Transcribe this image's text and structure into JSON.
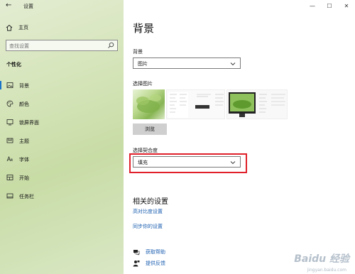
{
  "window": {
    "app_title": "设置",
    "controls": {
      "minimize": "—",
      "maximize": "☐",
      "close": "✕"
    }
  },
  "sidebar": {
    "home_label": "主页",
    "search": {
      "placeholder": "查找设置"
    },
    "section_title": "个性化",
    "items": [
      {
        "label": "背景",
        "icon": "image-icon",
        "selected": true
      },
      {
        "label": "颜色",
        "icon": "palette-icon",
        "selected": false
      },
      {
        "label": "锁屏界面",
        "icon": "lock-screen-icon",
        "selected": false
      },
      {
        "label": "主题",
        "icon": "theme-icon",
        "selected": false
      },
      {
        "label": "字体",
        "icon": "font-icon",
        "selected": false
      },
      {
        "label": "开始",
        "icon": "start-icon",
        "selected": false
      },
      {
        "label": "任务栏",
        "icon": "taskbar-icon",
        "selected": false
      }
    ]
  },
  "main": {
    "page_title": "背景",
    "background": {
      "label": "背景",
      "value": "图片"
    },
    "choose_picture": {
      "label": "选择图片",
      "browse_label": "浏览"
    },
    "fit": {
      "label": "选择契合度",
      "value": "填充"
    },
    "related": {
      "title": "相关的设置",
      "links": [
        "高对比度设置",
        "同步你的设置"
      ]
    },
    "help": {
      "get_help": "获取帮助",
      "feedback": "提供反馈"
    }
  },
  "watermark": {
    "brand": "Baidu 经验",
    "url": "jingyan.baidu.com"
  },
  "colors": {
    "accent": "#1a73c8",
    "link": "#1c5fb0",
    "highlight": "#e0202a"
  }
}
